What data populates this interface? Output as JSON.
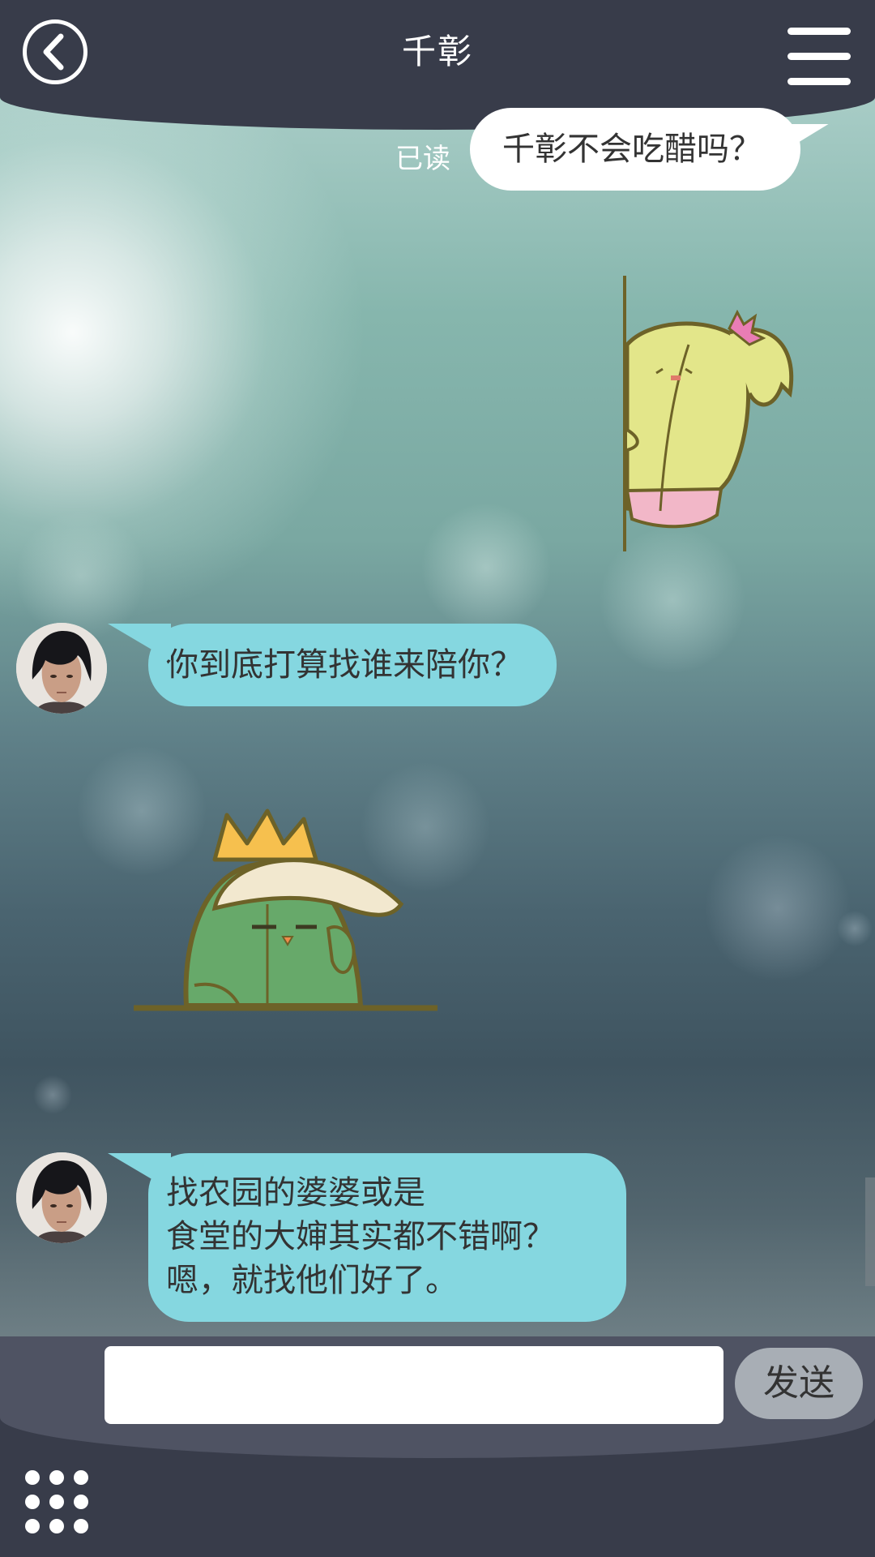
{
  "header": {
    "title": "千彰",
    "back_icon": "back-chevron-icon",
    "menu_icon": "hamburger-menu-icon"
  },
  "messages": [
    {
      "side": "out",
      "status": "已读",
      "text": "千彰不会吃醋吗？"
    },
    {
      "side": "out",
      "type": "sticker",
      "sticker": "yellow-cactus-peeking-sticker"
    },
    {
      "side": "in",
      "text": "你到底打算找谁来陪你？"
    },
    {
      "side": "in",
      "type": "sticker",
      "sticker": "green-cactus-crown-sticker"
    },
    {
      "side": "in",
      "lines": [
        "找农园的婆婆或是",
        "食堂的大婶其实都不错啊？",
        "嗯，就找他们好了。"
      ]
    }
  ],
  "input": {
    "placeholder": "",
    "value": "",
    "send_label": "发送",
    "apps_icon": "nine-dot-grid-icon"
  },
  "colors": {
    "header_bg": "#383c4a",
    "incoming_bubble": "#85d7e0",
    "outgoing_bubble": "#ffffff",
    "send_button": "#a8aeb5"
  }
}
